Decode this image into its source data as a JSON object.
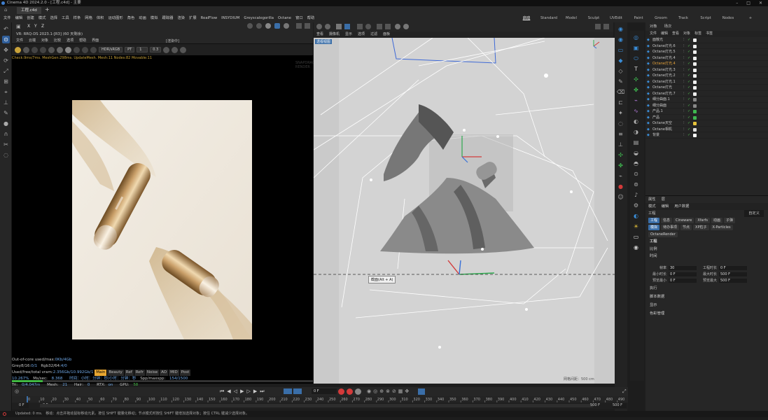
{
  "titlebar": {
    "title": "Cinema 4D 2024.2.0 - [工程.c4d] - 主要",
    "win_min": "–",
    "win_max": "□",
    "win_close": "✕"
  },
  "tabbar": {
    "doc_tab": "工程.c4d",
    "add": "+"
  },
  "menu": {
    "items": [
      "文件",
      "编辑",
      "创建",
      "模式",
      "选择",
      "工具",
      "样条",
      "网格",
      "体积",
      "运动图形",
      "角色",
      "动画",
      "模拟",
      "跟踪器",
      "渲染",
      "扩展",
      "RealFlow",
      "INSYDIUM",
      "Greyscalegorilla",
      "Octane",
      "窗口",
      "帮助"
    ],
    "layouts": [
      "启动",
      "Standard",
      "Model",
      "Sculpt",
      "UVEdit",
      "Paint",
      "Groom",
      "Track",
      "Script",
      "Nodes",
      "+"
    ],
    "active_layout": "启动"
  },
  "render_view": {
    "title": "VR: RRQ-DS 2023.1-[R3] (60 天剩余)",
    "menu": [
      "文件",
      "云端",
      "对象",
      "比较",
      "选项",
      "帮助",
      "界面"
    ],
    "overlay_label": "[渲染中]",
    "color_space": "HDR/sRGB",
    "kernel": "PT",
    "value1": "1",
    "value2": "0.3",
    "stats_line": "Check:9ms/7ms. MeshGen:298ms. UpdateMesh. Mesh:11 Nodes:82 Movable:11",
    "watermark": "SNAPDRAGON RENDER",
    "status": {
      "out_of_core": "Out-of-core used/max:",
      "out_of_core_val": "0Kb/4Gb",
      "grey": "Grey8/16:",
      "grey_val": "0/1",
      "rgb": "Rgb32/64:",
      "rgb_val": "4/0",
      "vram": "Used/free/total vram:",
      "vram_val": "2.356Gb/10.992Gb/1",
      "passes": [
        "Main",
        "Beauty",
        "Ref",
        "Refr",
        "Noise",
        "AO",
        "MID",
        "Post"
      ],
      "active_pass": "Main",
      "percent": "10.267%",
      "mssec_label": "Ms/sec:",
      "mssec": "8.368",
      "time": "时间：小时：分钟：秒/小时：分钟：秒",
      "spp_label": "Spp/maxspp:",
      "spp": "154/1500",
      "tri_label": "Tri:",
      "tri": "0/4.047m",
      "mesh_label": "Mesh:",
      "mesh": "21",
      "hair_label": "Hair:",
      "hair": "0",
      "rtx_label": "RTX:",
      "rtx": "on",
      "gpu_label": "GPU:",
      "gpu": "58"
    },
    "progress": 0.10267
  },
  "viewport": {
    "menu": [
      "查看",
      "摄像机",
      "显示",
      "选项",
      "过滤",
      "面板"
    ],
    "camera_tag": "透视视图",
    "tooltip": "截面(Alt + A)",
    "grid_label": "网格间距：500 cm"
  },
  "objects": {
    "tabs": [
      "对象",
      "场次"
    ],
    "menu": [
      "文件",
      "编辑",
      "查看",
      "对象",
      "标签",
      "书签"
    ],
    "rows": [
      {
        "name": "面散光"
      },
      {
        "name": "Octane灯光.6"
      },
      {
        "name": "Octane灯光.5"
      },
      {
        "name": "Octane灯光.4"
      },
      {
        "name": "Octane灯光.4",
        "active": true
      },
      {
        "name": "Octane灯光.3"
      },
      {
        "name": "Octane灯光.2"
      },
      {
        "name": "Octane灯光.1"
      },
      {
        "name": "Octane灯光"
      },
      {
        "name": "Octane灯光.7"
      },
      {
        "name": "细分曲面.1"
      },
      {
        "name": "细分曲面"
      },
      {
        "name": "产品.1"
      },
      {
        "name": "产品"
      },
      {
        "name": "Octane天空"
      },
      {
        "name": "Octane相机"
      },
      {
        "name": "背景"
      }
    ]
  },
  "attributes": {
    "tabs": [
      "属性",
      "层"
    ],
    "menu": [
      "模式",
      "编辑",
      "用户数据"
    ],
    "title": "工程",
    "preset": "自定义",
    "tab_row1": [
      "工程",
      "信息",
      "Cineware",
      "Xfarfs",
      "动画",
      "子弹"
    ],
    "tab_row2": [
      "模拟",
      "待办事项",
      "节点",
      "XP粒子",
      "X-Particles"
    ],
    "tab_row3": [
      "OctaneRender"
    ],
    "section": "工程",
    "groups": [
      "比例",
      "时间",
      "执行",
      "脚本数据",
      "显示",
      "色彩管理"
    ],
    "fields": {
      "fps_label": "帧率",
      "fps": "30",
      "min_label": "最小时长",
      "min": "0 F",
      "preview_min_label": "预览最小",
      "preview_min": "0 F",
      "proj_time_label": "工程时长",
      "proj_time": "0 F",
      "max_label": "最大时长",
      "max": "500 F",
      "preview_max_label": "预览最大",
      "preview_max": "500 F"
    }
  },
  "timeline": {
    "current": "0 F",
    "ticks": [
      "0",
      "10",
      "20",
      "30",
      "40",
      "50",
      "60",
      "70",
      "80",
      "90",
      "100",
      "110",
      "120",
      "130",
      "140",
      "150",
      "160",
      "170",
      "180",
      "190",
      "200",
      "210",
      "220",
      "230",
      "240",
      "250",
      "260",
      "270",
      "280",
      "290",
      "300",
      "310",
      "320",
      "330",
      "340",
      "350",
      "360",
      "370",
      "380",
      "390",
      "400",
      "410",
      "420",
      "430",
      "440",
      "450",
      "460",
      "470",
      "480",
      "490",
      "500"
    ],
    "start": "0 F",
    "start2": "0 F",
    "end": "500 F",
    "end2": "500 F"
  },
  "statusbar": {
    "text": "Updated: 0 ms.",
    "hint": "移动：点击并拖动鼠标移动元素。按住 SHIFT 键量化移动；节点模式时按住 SHIFT 键增加选择对象；按住 CTRL 键减少选择对象。"
  },
  "colors": {
    "accent": "#3a6ea8",
    "panel": "#262626",
    "viewport_bg": "#c8c8c8",
    "photo_bg": "#efe9df"
  }
}
